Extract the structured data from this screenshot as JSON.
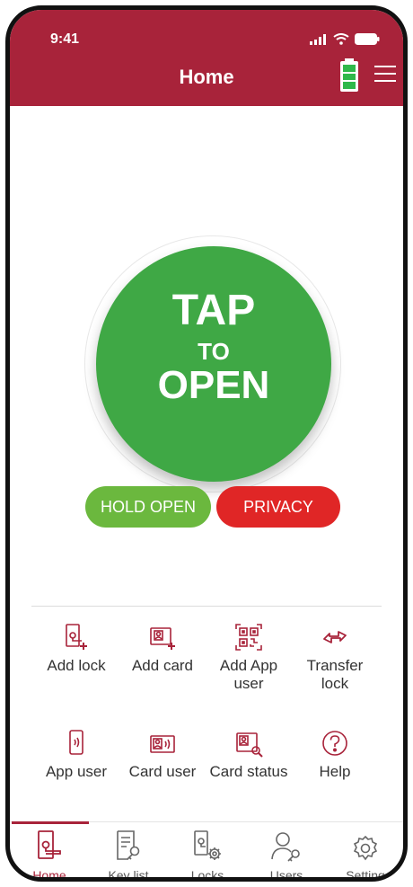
{
  "status": {
    "time": "9:41"
  },
  "header": {
    "title": "Home"
  },
  "tap": {
    "line1": "TAP",
    "line2": "TO",
    "line3": "OPEN"
  },
  "buttons": {
    "hold_open": "HOLD OPEN",
    "privacy": "PRIVACY"
  },
  "actions": [
    {
      "label": "Add lock",
      "icon": "add-lock-icon"
    },
    {
      "label": "Add card",
      "icon": "add-card-icon"
    },
    {
      "label": "Add App user",
      "icon": "qr-code-icon"
    },
    {
      "label": "Transfer lock",
      "icon": "transfer-icon"
    },
    {
      "label": "App user",
      "icon": "phone-icon"
    },
    {
      "label": "Card user",
      "icon": "card-icon"
    },
    {
      "label": "Card status",
      "icon": "card-status-icon"
    },
    {
      "label": "Help",
      "icon": "help-icon"
    }
  ],
  "tabs": [
    {
      "label": "Home",
      "icon": "home-lock-icon",
      "active": true
    },
    {
      "label": "Key list",
      "icon": "key-list-icon"
    },
    {
      "label": "Locks",
      "icon": "locks-icon"
    },
    {
      "label": "Users",
      "icon": "users-icon"
    },
    {
      "label": "Setting",
      "icon": "gear-icon"
    }
  ],
  "colors": {
    "primary": "#a8233a",
    "green": "#3fa845",
    "hold": "#6bb83e",
    "privacy": "#e02626",
    "battery": "#2fb84a"
  }
}
